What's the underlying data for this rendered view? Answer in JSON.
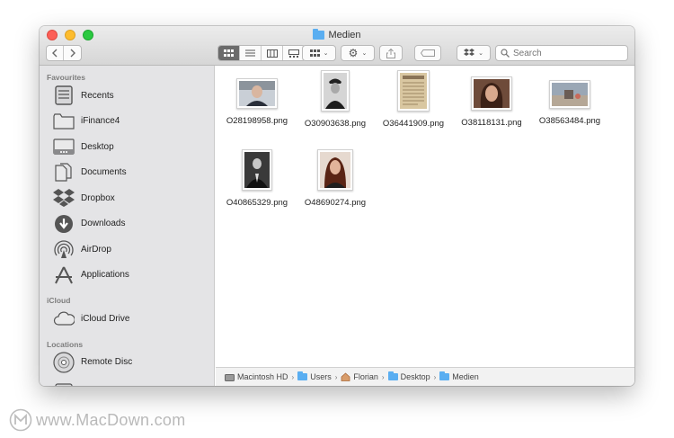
{
  "window": {
    "title": "Medien"
  },
  "toolbar": {
    "back_icon": "chevron-left-icon",
    "forward_icon": "chevron-right-icon",
    "view_modes": [
      "icon-view",
      "list-view",
      "column-view",
      "gallery-view"
    ],
    "search_placeholder": "Search"
  },
  "sidebar": {
    "favourites_header": "Favourites",
    "favourites": [
      {
        "label": "Recents",
        "icon": "recents-icon"
      },
      {
        "label": "iFinance4",
        "icon": "folder-icon"
      },
      {
        "label": "Desktop",
        "icon": "desktop-icon"
      },
      {
        "label": "Documents",
        "icon": "documents-icon"
      },
      {
        "label": "Dropbox",
        "icon": "dropbox-icon"
      },
      {
        "label": "Downloads",
        "icon": "downloads-icon"
      },
      {
        "label": "AirDrop",
        "icon": "airdrop-icon"
      },
      {
        "label": "Applications",
        "icon": "applications-icon"
      }
    ],
    "icloud_header": "iCloud",
    "icloud": [
      {
        "label": "iCloud Drive",
        "icon": "cloud-icon"
      }
    ],
    "locations_header": "Locations",
    "locations": [
      {
        "label": "Remote Disc",
        "icon": "disc-icon"
      }
    ]
  },
  "files": [
    {
      "name": "O28198958.png",
      "thumb": "man-portrait"
    },
    {
      "name": "O30903638.png",
      "thumb": "officer-portrait"
    },
    {
      "name": "O36441909.png",
      "thumb": "newspaper"
    },
    {
      "name": "O38118131.png",
      "thumb": "woman-portrait"
    },
    {
      "name": "O38563484.png",
      "thumb": "landscape-photo"
    },
    {
      "name": "O40865329.png",
      "thumb": "man-suit-portrait"
    },
    {
      "name": "O48690274.png",
      "thumb": "woman-smiling-portrait"
    }
  ],
  "pathbar": {
    "segments": [
      {
        "label": "Macintosh HD",
        "icon": "harddisk-icon"
      },
      {
        "label": "Users",
        "icon": "folder-icon"
      },
      {
        "label": "Florian",
        "icon": "home-icon"
      },
      {
        "label": "Desktop",
        "icon": "folder-icon"
      },
      {
        "label": "Medien",
        "icon": "folder-icon"
      }
    ]
  },
  "watermark": {
    "text": "www.MacDown.com"
  },
  "colors": {
    "accent_folder": "#5aaef1",
    "sidebar_bg": "#e4e4e6"
  }
}
